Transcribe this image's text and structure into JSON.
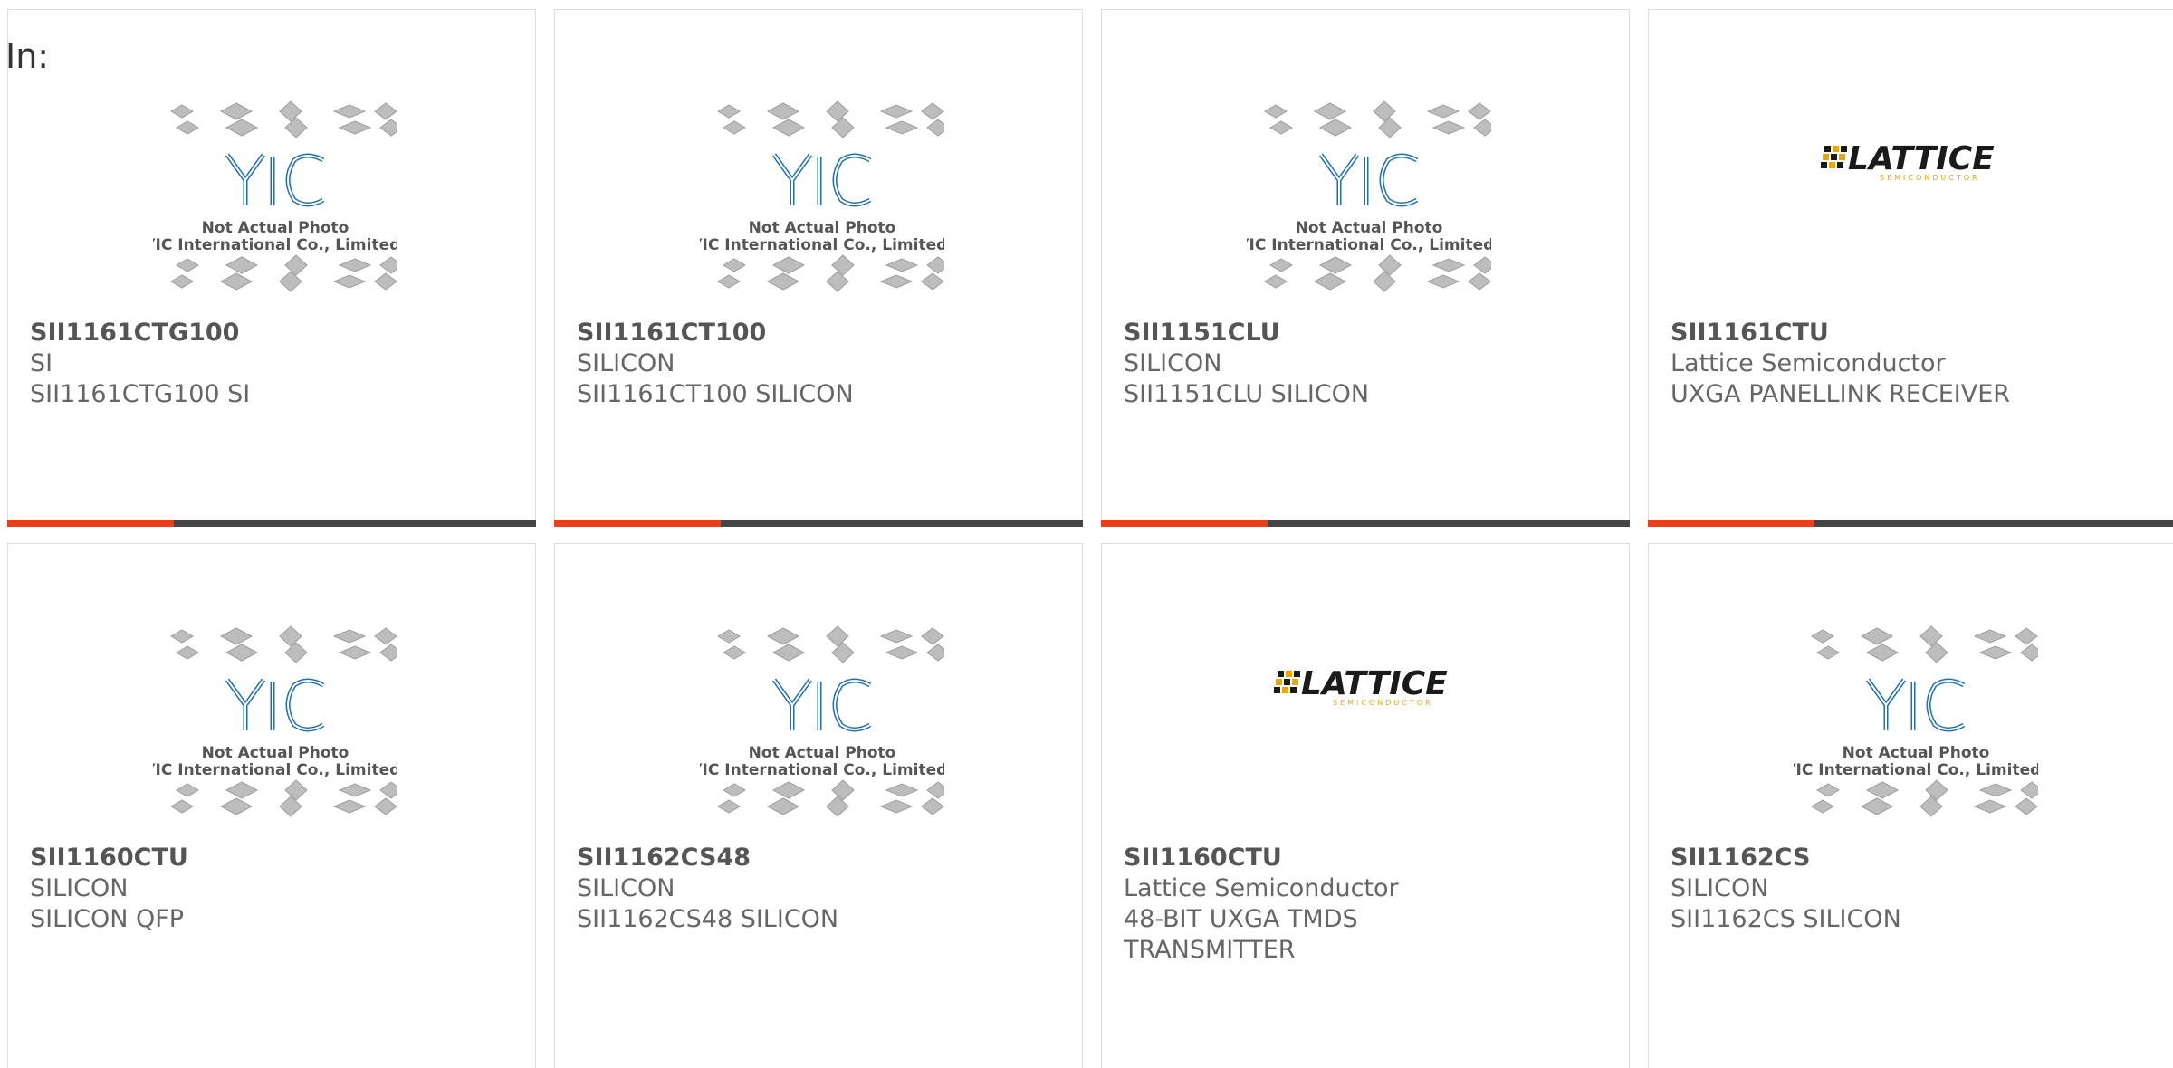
{
  "header": {
    "in_label": "In:"
  },
  "placeholder": {
    "line1": "Not Actual Photo",
    "line2": "YIC International Co., Limited.",
    "logo_text": "YIC"
  },
  "lattice": {
    "logo_text": "LATTICE",
    "logo_sub": "SEMICONDUCTOR"
  },
  "colors": {
    "accent": "#e5411f",
    "bar": "#444444",
    "yic_blue": "#1f6fb3",
    "lattice_gold": "#e8a800"
  },
  "products": [
    {
      "part": "SII1161CTG100",
      "maker": "SI",
      "desc": "SII1161CTG100 SI",
      "image": "yic-placeholder"
    },
    {
      "part": "SII1161CT100",
      "maker": "SILICON",
      "desc": "SII1161CT100 SILICON",
      "image": "yic-placeholder"
    },
    {
      "part": "SII1151CLU",
      "maker": "SILICON",
      "desc": "SII1151CLU SILICON",
      "image": "yic-placeholder"
    },
    {
      "part": "SII1161CTU",
      "maker": "Lattice Semiconductor",
      "desc": "UXGA PANELLINK RECEIVER",
      "image": "lattice-logo"
    },
    {
      "part": "SII1160CTU",
      "maker": "SILICON",
      "desc": "SILICON QFP",
      "image": "yic-placeholder"
    },
    {
      "part": "SII1162CS48",
      "maker": "SILICON",
      "desc": "SII1162CS48 SILICON",
      "image": "yic-placeholder"
    },
    {
      "part": "SII1160CTU",
      "maker": "Lattice Semiconductor",
      "desc": "48-BIT UXGA TMDS TRANSMITTER",
      "image": "lattice-logo"
    },
    {
      "part": "SII1162CS",
      "maker": "SILICON",
      "desc": "SII1162CS SILICON",
      "image": "yic-placeholder"
    }
  ]
}
